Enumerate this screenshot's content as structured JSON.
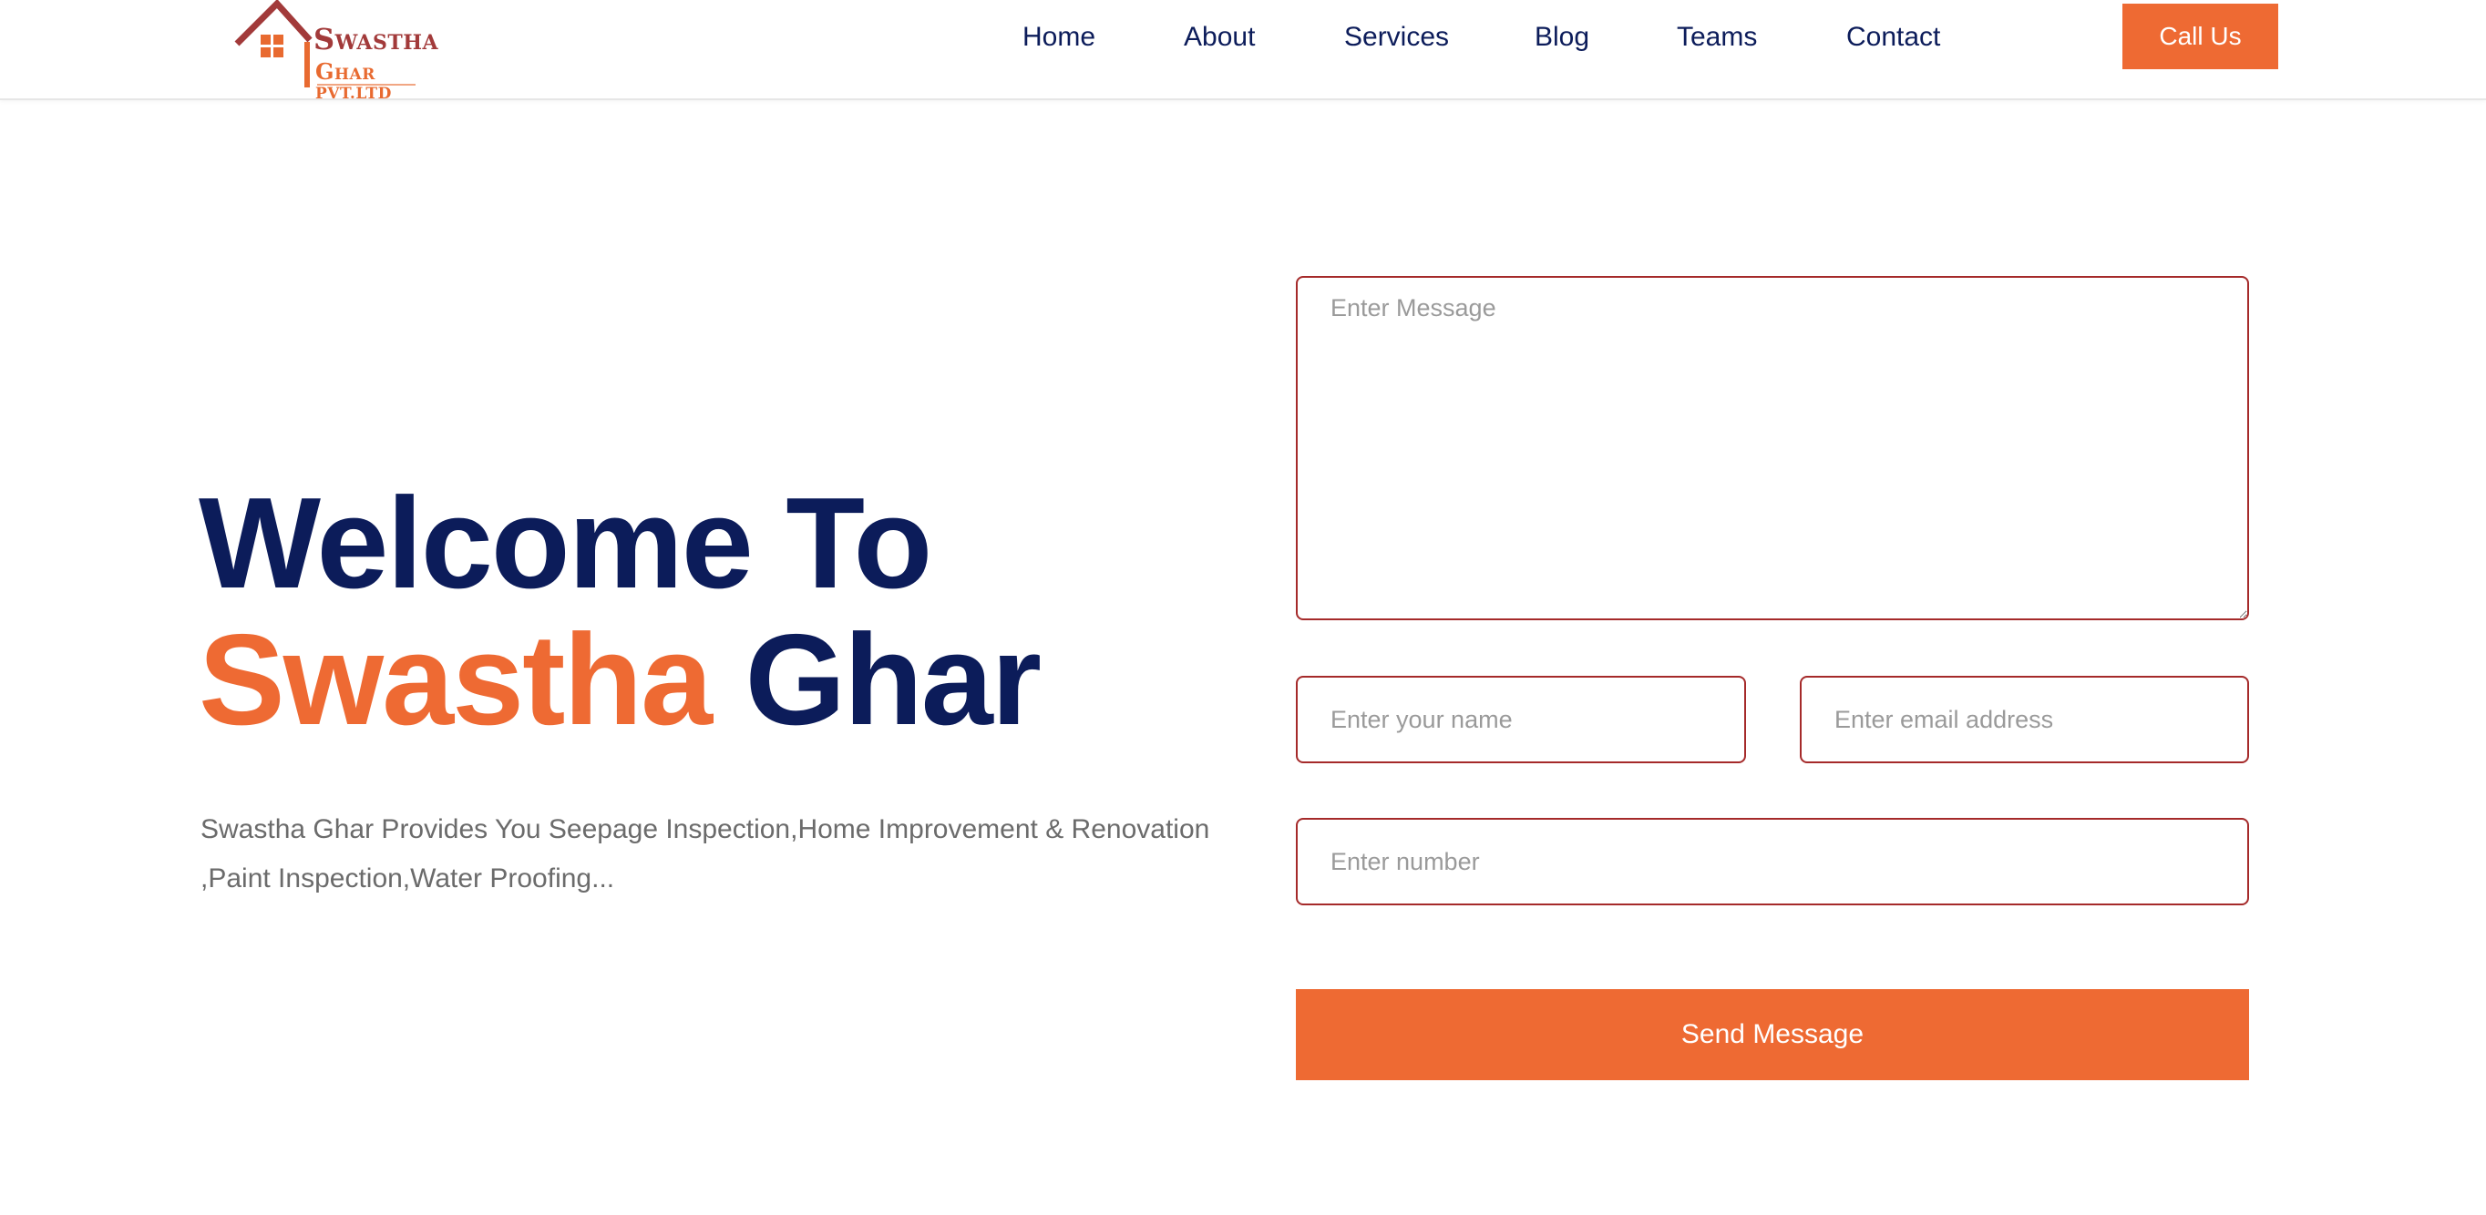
{
  "brand": {
    "logo_line1_initial": "S",
    "logo_line1_rest": "WASTHA",
    "logo_line2_initial": "G",
    "logo_line2_rest": "HAR PVT.LTD",
    "colors": {
      "primary": "#ee6a33",
      "navy": "#0c1c5a",
      "maroon": "#a23a3a"
    }
  },
  "nav": {
    "items": [
      {
        "label": "Home"
      },
      {
        "label": "About"
      },
      {
        "label": "Services"
      },
      {
        "label": "Blog"
      },
      {
        "label": "Teams"
      },
      {
        "label": "Contact"
      }
    ],
    "cta_label": "Call Us"
  },
  "hero": {
    "title_line1": "Welcome To",
    "title_accent": "Swastha",
    "title_rest": "Ghar",
    "description": "Swastha Ghar Provides You Seepage Inspection,Home Improvement & Renovation ,Paint Inspection,Water Proofing..."
  },
  "form": {
    "message_placeholder": "Enter Message",
    "name_placeholder": "Enter your name",
    "email_placeholder": "Enter email address",
    "number_placeholder": "Enter number",
    "submit_label": "Send Message"
  }
}
